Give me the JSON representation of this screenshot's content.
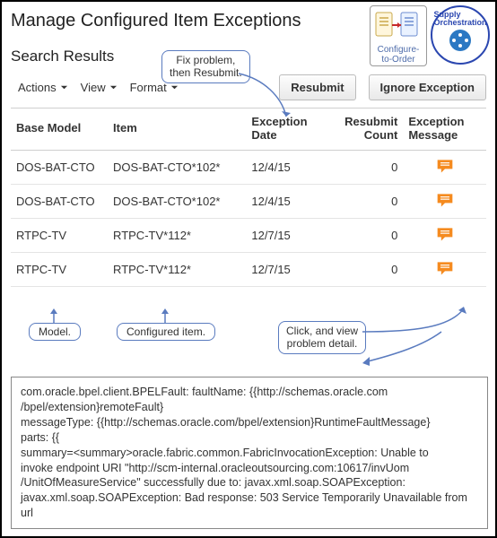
{
  "header": {
    "page_title": "Manage Configured Item Exceptions",
    "search_results_title": "Search Results",
    "cto": {
      "l1": "Configure-",
      "l2": "to-Order"
    },
    "orch": {
      "l1": "Supply",
      "l2": "Orchestration"
    }
  },
  "toolbar": {
    "actions": "Actions",
    "view": "View",
    "format": "Format",
    "resubmit": "Resubmit",
    "ignore": "Ignore Exception"
  },
  "columns": {
    "base_model": "Base Model",
    "item": "Item",
    "ex_date_l1": "Exception",
    "ex_date_l2": "Date",
    "re_ct_l1": "Resubmit",
    "re_ct_l2": "Count",
    "ex_msg_l1": "Exception",
    "ex_msg_l2": "Message"
  },
  "rows": [
    {
      "base_model": "DOS-BAT-CTO",
      "item": "DOS-BAT-CTO*102*",
      "ex_date": "12/4/15",
      "re_ct": "0"
    },
    {
      "base_model": "DOS-BAT-CTO",
      "item": "DOS-BAT-CTO*102*",
      "ex_date": "12/4/15",
      "re_ct": "0"
    },
    {
      "base_model": "RTPC-TV",
      "item": "RTPC-TV*112*",
      "ex_date": "12/7/15",
      "re_ct": "0"
    },
    {
      "base_model": "RTPC-TV",
      "item": "RTPC-TV*112*",
      "ex_date": "12/7/15",
      "re_ct": "0"
    }
  ],
  "callouts": {
    "fix_l1": "Fix problem,",
    "fix_l2": "then Resubmit.",
    "model": "Model.",
    "config_item": "Configured item.",
    "view_detail_l1": "Click, and view",
    "view_detail_l2": "problem detail."
  },
  "error": {
    "l1": "com.oracle.bpel.client.BPELFault: faultName: {{http://schemas.oracle.com",
    "l2": "/bpel/extension}remoteFault}",
    "l3": "messageType: {{http://schemas.oracle.com/bpel/extension}RuntimeFaultMessage}",
    "l4": "parts: {{",
    "l5": "summary=<summary>oracle.fabric.common.FabricInvocationException: Unable to",
    "l6": "invoke endpoint URI \"http://scm-internal.oracleoutsourcing.com:10617/invUom",
    "l7": "/UnitOfMeasureService\" successfully due to: javax.xml.soap.SOAPException:",
    "l8": "javax.xml.soap.SOAPException: Bad response: 503 Service Temporarily Unavailable from",
    "l9": "url"
  }
}
